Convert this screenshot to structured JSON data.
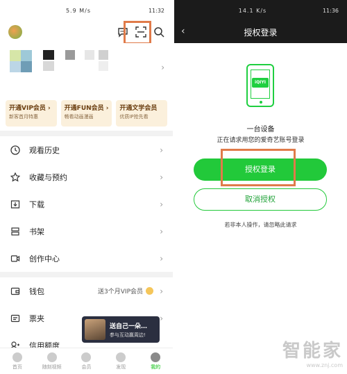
{
  "left": {
    "status": {
      "time": "11:32",
      "net": "5.9 M/s"
    },
    "promos": [
      {
        "title": "开通VIP会员 ›",
        "sub": "新客首月特惠"
      },
      {
        "title": "开通FUN会员 ›",
        "sub": "畅看动画漫画"
      },
      {
        "title": "开通文学会员",
        "sub": "优质IP抢先看"
      }
    ],
    "menu1": [
      {
        "label": "观看历史",
        "icon": "clock-icon"
      },
      {
        "label": "收藏与预约",
        "icon": "star-icon"
      },
      {
        "label": "下载",
        "icon": "download-icon"
      },
      {
        "label": "书架",
        "icon": "bookshelf-icon"
      },
      {
        "label": "创作中心",
        "icon": "video-icon"
      }
    ],
    "menu2": [
      {
        "label": "钱包",
        "icon": "wallet-icon",
        "extra": "送3个月VIP会员"
      },
      {
        "label": "票夹",
        "icon": "ticket-icon"
      },
      {
        "label": "信用额度",
        "icon": "credit-icon"
      }
    ],
    "toast": {
      "title": "送自己一朵…",
      "sub": "参与互动赢周边!"
    },
    "tabs": [
      {
        "label": "首页"
      },
      {
        "label": "随刻视频"
      },
      {
        "label": "会员"
      },
      {
        "label": "发现"
      },
      {
        "label": "我的"
      }
    ]
  },
  "right": {
    "status": {
      "time": "11:36",
      "net": "14.1 K/s"
    },
    "title": "授权登录",
    "logo_text": "iQIYI",
    "line1": "一台设备",
    "line2": "正在请求用您的爱奇艺账号登录",
    "confirm_label": "授权登录",
    "cancel_label": "取消授权",
    "note": "若非本人操作，请忽略此请求"
  },
  "watermark": {
    "brand": "智能家",
    "url": "www.znj.com"
  },
  "colors": {
    "accent_green": "#22c93a",
    "highlight": "#e07b4a"
  }
}
